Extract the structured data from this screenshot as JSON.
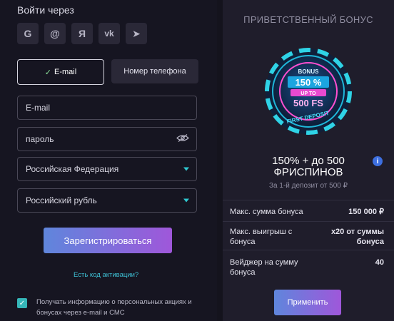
{
  "left": {
    "login_title": "Войти через",
    "socials": [
      {
        "icon": "google-icon",
        "glyph": "G"
      },
      {
        "icon": "mailru-icon",
        "glyph": "@"
      },
      {
        "icon": "yandex-icon",
        "glyph": "Я"
      },
      {
        "icon": "vk-icon",
        "glyph": "vk"
      },
      {
        "icon": "telegram-icon",
        "glyph": "➤"
      }
    ],
    "tabs": {
      "email": "E-mail",
      "phone": "Номер телефона"
    },
    "fields": {
      "email_placeholder": "E-mail",
      "password_placeholder": "пароль",
      "country": "Российская Федерация",
      "currency": "Российский рубль"
    },
    "register_button": "Зарегистрироваться",
    "activation_link": "Есть код активации?",
    "consent_text": "Получать информацию о персональных акциях и бонусах через e-mail и СМС",
    "consent_checked": true
  },
  "right": {
    "title": "ПРИВЕТСТВЕННЫЙ БОНУС",
    "chip": {
      "line1": "BONUS",
      "line2": "150 %",
      "line3": "UP TO",
      "line4": "500 FS",
      "arc": "FIRST DEPOSIT"
    },
    "headline_line1": "150% + до 500",
    "headline_line2": "ФРИСПИНОВ",
    "subtitle": "За 1-й депозит от 500 ₽",
    "rows": [
      {
        "label": "Макс. сумма бонуса",
        "value": "150 000 ₽"
      },
      {
        "label": "Макс. выигрыш с бонуса",
        "value": "x20 от суммы бонуса"
      },
      {
        "label": "Вейджер на сумму бонуса",
        "value": "40"
      }
    ],
    "apply_button": "Применить"
  },
  "colors": {
    "accent_gradient_start": "#5f86dc",
    "accent_gradient_end": "#9f57da",
    "link": "#3ec0d4",
    "checkbox": "#36b7b9"
  }
}
